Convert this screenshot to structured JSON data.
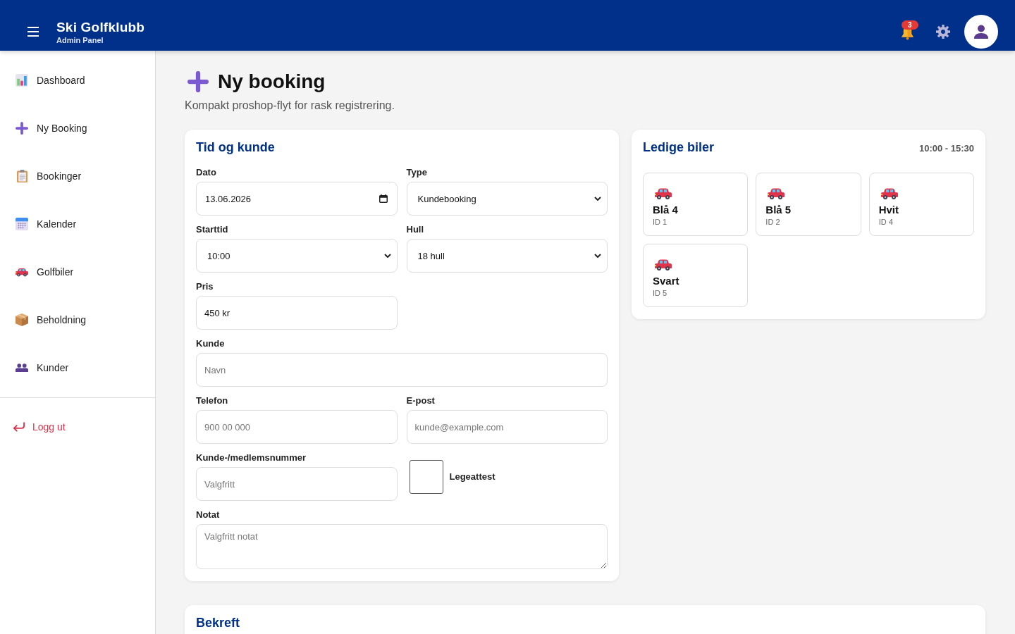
{
  "header": {
    "title": "Ski Golfklubb",
    "subtitle": "Admin Panel",
    "notification_count": "3"
  },
  "sidebar": {
    "items": [
      {
        "label": "Dashboard",
        "selected": false
      },
      {
        "label": "Ny Booking",
        "selected": false
      },
      {
        "label": "Bookinger",
        "selected": false
      },
      {
        "label": "Kalender",
        "selected": false
      },
      {
        "label": "Golfbiler",
        "selected": false
      },
      {
        "label": "Beholdning",
        "selected": false
      },
      {
        "label": "Kunder",
        "selected": false
      }
    ],
    "logout": "Logg ut"
  },
  "page": {
    "title": "Ny booking",
    "subtitle": "Kompakt proshop-flyt for rask registrering."
  },
  "booking_form": {
    "title": "Tid og kunde",
    "fields": [
      {
        "kind": "date",
        "label": "Dato",
        "value": "13.06.2026"
      },
      {
        "kind": "select",
        "label": "Type",
        "value": "Kundebooking"
      },
      {
        "kind": "select",
        "label": "Starttid",
        "value": "10:00"
      },
      {
        "kind": "select",
        "label": "Hull",
        "value": "18 hull"
      },
      {
        "kind": "text",
        "label": "Pris",
        "value": "450 kr"
      },
      {
        "kind": "text",
        "label": "Kunde",
        "placeholder": "Navn"
      },
      {
        "kind": "text",
        "label": "Telefon",
        "placeholder": "900 00 000"
      },
      {
        "kind": "text",
        "label": "E-post",
        "placeholder": "kunde@example.com"
      },
      {
        "kind": "text",
        "label": "Kunde-/medlemsnummer",
        "placeholder": "Valgfritt"
      },
      {
        "kind": "checkbox",
        "label": "Legeattest",
        "checked": false
      },
      {
        "kind": "textarea",
        "label": "Notat",
        "placeholder": "Valgfritt notat"
      }
    ]
  },
  "available_carts": {
    "title": "Ledige biler",
    "time_range": "10:00 - 15:30",
    "carts": [
      {
        "name": "Blå 4",
        "id": "ID 1"
      },
      {
        "name": "Blå 5",
        "id": "ID 2"
      },
      {
        "name": "Hvit",
        "id": "ID 4"
      },
      {
        "name": "Svart",
        "id": "ID 5"
      }
    ]
  },
  "confirm": {
    "title": "Bekreft"
  }
}
